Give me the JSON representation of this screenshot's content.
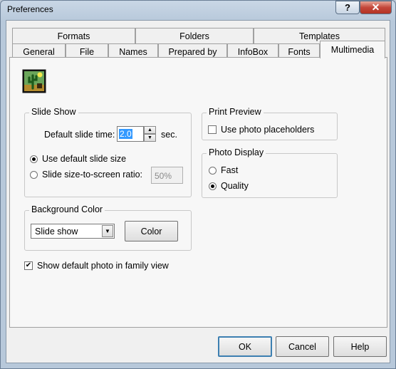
{
  "window": {
    "title": "Preferences"
  },
  "caption_buttons": {
    "help": "?",
    "close": "✕"
  },
  "tabs": {
    "row1": [
      "Formats",
      "Folders",
      "Templates"
    ],
    "row2": [
      "General",
      "File",
      "Names",
      "Prepared by",
      "InfoBox",
      "Fonts",
      "Multimedia"
    ],
    "active": "Multimedia"
  },
  "multimedia_icon": "cactus-photo-icon",
  "slide_show": {
    "legend": "Slide Show",
    "default_time_label": "Default slide time:",
    "default_time_value": "2.0",
    "time_unit": "sec.",
    "option_default_size": "Use default slide size",
    "option_ratio": "Slide size-to-screen ratio:",
    "ratio_value": "50%",
    "selected": "default"
  },
  "print_preview": {
    "legend": "Print Preview",
    "placeholders_label": "Use photo placeholders",
    "placeholders_checked": false
  },
  "photo_display": {
    "legend": "Photo Display",
    "option_fast": "Fast",
    "option_quality": "Quality",
    "selected": "Quality"
  },
  "background_color": {
    "legend": "Background Color",
    "selected": "Slide show",
    "color_button": "Color"
  },
  "family_view": {
    "label": "Show default photo in family view",
    "checked": true
  },
  "footer": {
    "ok": "OK",
    "cancel": "Cancel",
    "help": "Help"
  }
}
